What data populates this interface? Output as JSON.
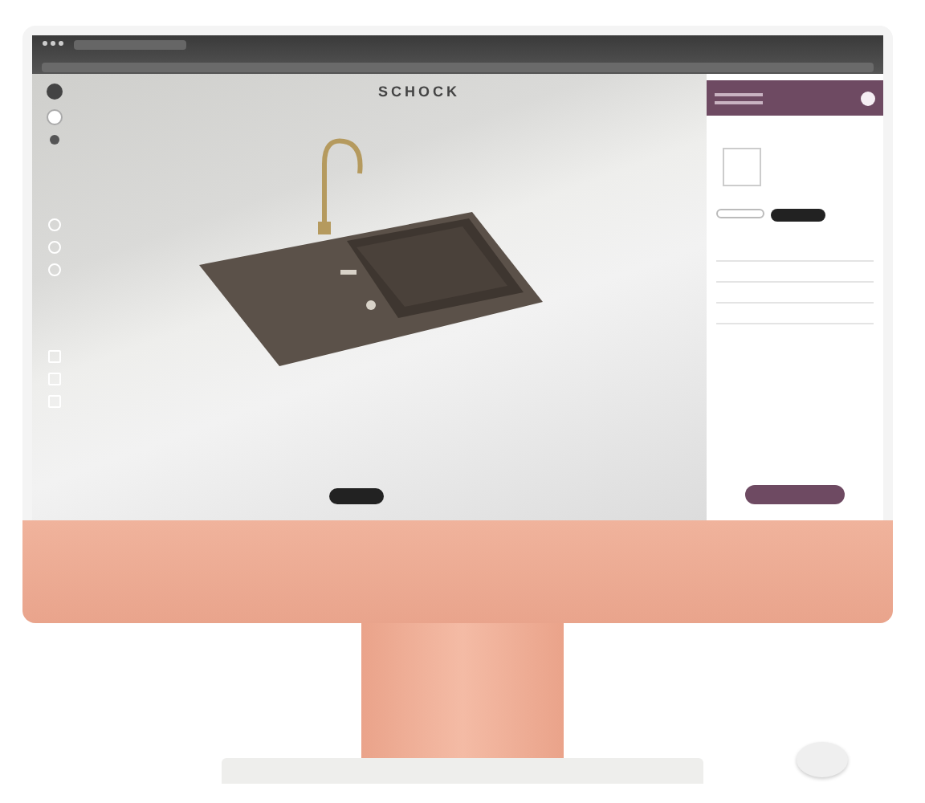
{
  "app": {
    "logo": "SCHOCK"
  }
}
